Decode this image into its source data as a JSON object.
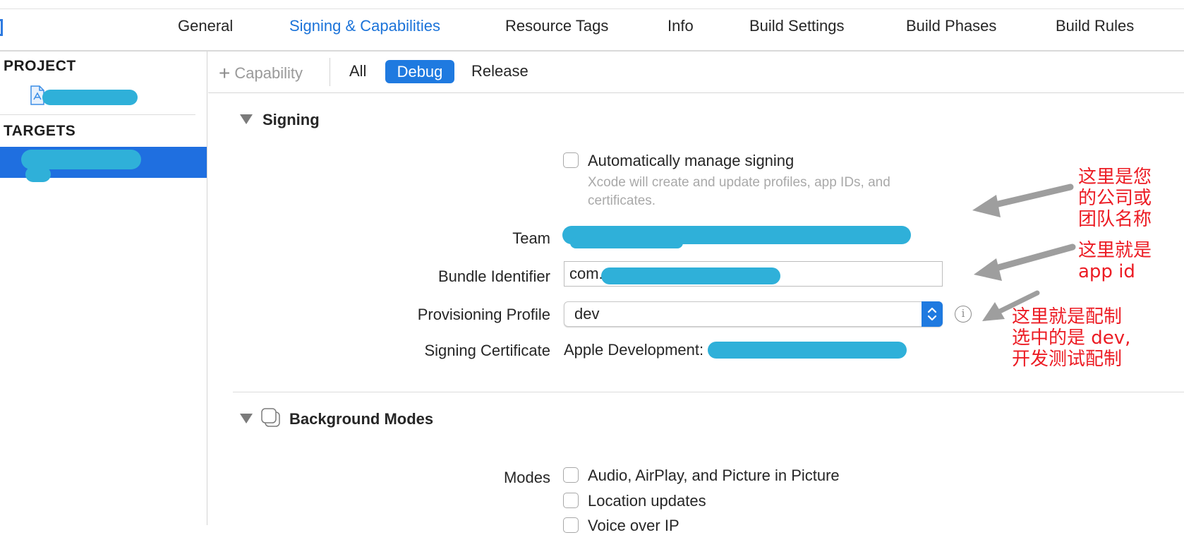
{
  "tabs": [
    {
      "label": "General",
      "active": false
    },
    {
      "label": "Signing & Capabilities",
      "active": true
    },
    {
      "label": "Resource Tags",
      "active": false
    },
    {
      "label": "Info",
      "active": false
    },
    {
      "label": "Build Settings",
      "active": false
    },
    {
      "label": "Build Phases",
      "active": false
    },
    {
      "label": "Build Rules",
      "active": false
    }
  ],
  "sidebar": {
    "project_title": "PROJECT",
    "targets_title": "TARGETS"
  },
  "toolbar": {
    "capability_label": "Capability",
    "filters": [
      "All",
      "Debug",
      "Release"
    ],
    "selected_filter": "Debug"
  },
  "signing": {
    "title": "Signing",
    "auto_manage_label": "Automatically manage signing",
    "auto_manage_checked": false,
    "auto_manage_help": "Xcode will create and update profiles, app IDs, and certificates.",
    "team_label": "Team",
    "bundle_label": "Bundle Identifier",
    "bundle_value": "com.",
    "profile_label": "Provisioning Profile",
    "profile_value": "dev",
    "certificate_label": "Signing Certificate",
    "certificate_value": "Apple Development:"
  },
  "background_modes": {
    "title": "Background Modes",
    "modes_label": "Modes",
    "options": [
      {
        "label": "Audio, AirPlay, and Picture in Picture",
        "checked": false
      },
      {
        "label": "Location updates",
        "checked": false
      },
      {
        "label": "Voice over IP",
        "checked": false
      }
    ]
  },
  "annotations": {
    "team_note": [
      "这里是您",
      "的公司或",
      "团队名称"
    ],
    "bundle_note": [
      "这里就是",
      "app id"
    ],
    "profile_note": [
      "这里就是配制",
      "选中的是 dev,",
      "开发测试配制"
    ]
  },
  "colors": {
    "accent": "#1f7ae0",
    "annotation_red": "#ec1c24",
    "annotation_arrow": "#9e9e9e",
    "redaction": "#2fb0d9"
  }
}
